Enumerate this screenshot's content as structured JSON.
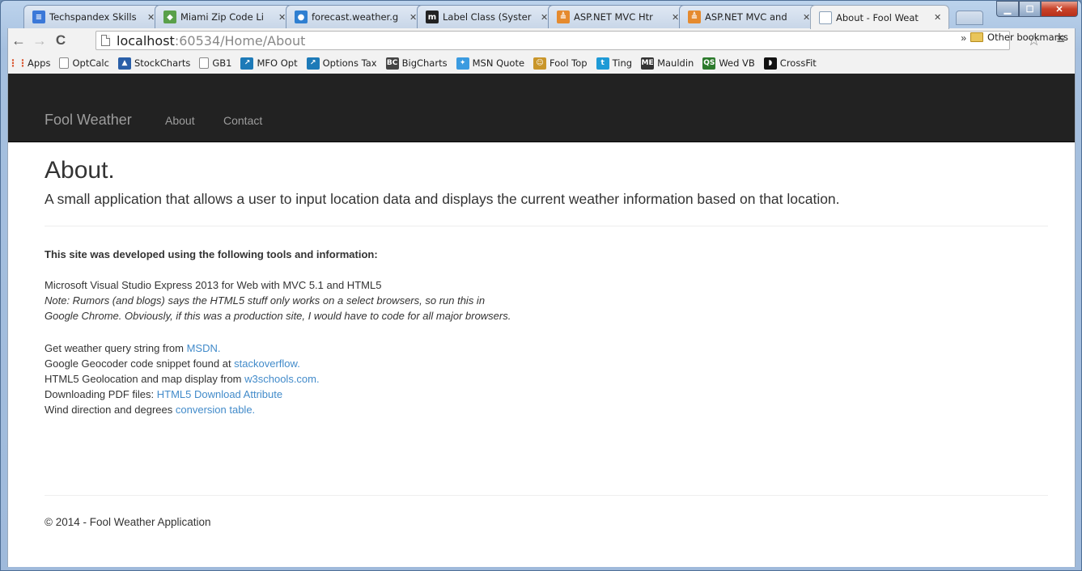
{
  "browser": {
    "tabs": [
      {
        "title": "Techspandex Skills",
        "favicon": "document-icon",
        "color": "#3b78d8",
        "glyph": "≡"
      },
      {
        "title": "Miami Zip Code Li",
        "favicon": "maps-icon",
        "color": "#5aa04a",
        "glyph": "◆"
      },
      {
        "title": "forecast.weather.g",
        "favicon": "weather-icon",
        "color": "#2f7fd1",
        "glyph": "●"
      },
      {
        "title": "Label Class (Syster",
        "favicon": "msdn-icon",
        "color": "#222222",
        "glyph": "m"
      },
      {
        "title": "ASP.NET MVC Htr",
        "favicon": "stackoverflow-icon",
        "color": "#e58a2e",
        "glyph": "≜"
      },
      {
        "title": "ASP.NET MVC and",
        "favicon": "stackoverflow-icon",
        "color": "#e58a2e",
        "glyph": "≜"
      },
      {
        "title": "About - Fool Weat",
        "favicon": "page-icon",
        "color": "#c8d3df",
        "glyph": ""
      }
    ],
    "url_host": "localhost",
    "url_rest": ":60534/Home/About",
    "bookmarks": [
      {
        "label": "Apps",
        "icon": "apps-grid-icon",
        "color": "#d9532c",
        "glyph": "⋮⋮"
      },
      {
        "label": "OptCalc",
        "icon": "page-icon",
        "color": "#ffffff",
        "glyph": ""
      },
      {
        "label": "StockCharts",
        "icon": "stockcharts-icon",
        "color": "#2a5fa8",
        "glyph": "▲"
      },
      {
        "label": "GB1",
        "icon": "page-icon",
        "color": "#ffffff",
        "glyph": ""
      },
      {
        "label": "MFO Opt",
        "icon": "chart-icon",
        "color": "#1d7ab8",
        "glyph": "↗"
      },
      {
        "label": "Options Tax",
        "icon": "chart-icon",
        "color": "#1d7ab8",
        "glyph": "↗"
      },
      {
        "label": "BigCharts",
        "icon": "bigcharts-icon",
        "color": "#444444",
        "glyph": "BC"
      },
      {
        "label": "MSN Quote",
        "icon": "msn-icon",
        "color": "#3b9be0",
        "glyph": "✦"
      },
      {
        "label": "Fool Top",
        "icon": "fool-icon",
        "color": "#c9962a",
        "glyph": "☺"
      },
      {
        "label": "Ting",
        "icon": "ting-icon",
        "color": "#1e9ad6",
        "glyph": "t"
      },
      {
        "label": "Mauldin",
        "icon": "mauldin-icon",
        "color": "#333333",
        "glyph": "ME"
      },
      {
        "label": "Wed VB",
        "icon": "qs-icon",
        "color": "#2c7a2c",
        "glyph": "QS"
      },
      {
        "label": "CrossFit",
        "icon": "crossfit-icon",
        "color": "#111111",
        "glyph": "◗"
      }
    ],
    "bookmarks_overflow": "»",
    "other_bookmarks": "Other bookmarks"
  },
  "site": {
    "brand": "Fool Weather",
    "nav": [
      "About",
      "Contact"
    ],
    "title": "About.",
    "lead": "A small application that allows a user to input location data and displays the current weather information based on that location.",
    "tools_heading": "This site was developed using the following tools and information:",
    "tool_line": "Microsoft Visual Studio Express 2013 for Web with MVC 5.1 and HTML5",
    "note_line1": "Note: Rumors (and blogs) says the HTML5 stuff only works on a select browsers, so run this in",
    "note_line2": "Google Chrome. Obviously, if this was a production site, I would have to code for all major browsers.",
    "credits": [
      {
        "prefix": "Get weather query string from ",
        "link": "MSDN."
      },
      {
        "prefix": "Google Geocoder code snippet found at ",
        "link": "stackoverflow."
      },
      {
        "prefix": "HTML5 Geolocation and map display from ",
        "link": "w3schools.com."
      },
      {
        "prefix": "Downloading PDF files: ",
        "link": "HTML5 Download Attribute"
      },
      {
        "prefix": "Wind direction and degrees ",
        "link": "conversion table."
      }
    ],
    "footer": "© 2014 - Fool Weather Application"
  }
}
